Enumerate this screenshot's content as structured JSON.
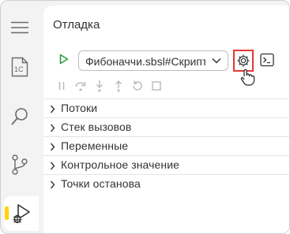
{
  "panel": {
    "title": "Отладка"
  },
  "activity_bar": {
    "items": [
      {
        "icon": "menu-icon"
      },
      {
        "icon": "1c-file-icon"
      },
      {
        "icon": "search-icon"
      },
      {
        "icon": "source-control-icon"
      },
      {
        "icon": "run-debug-icon",
        "active": true
      }
    ],
    "active_indicator_color": "#ffd400"
  },
  "toolbar": {
    "run_icon": "play-icon",
    "run_color": "#2e9e44",
    "configuration": "Фибоначчи.sbsl#Скрипт",
    "settings_icon": "gear-icon",
    "settings_highlight_color": "#e53935",
    "terminal_icon": "terminal-icon"
  },
  "debug_controls": [
    {
      "icon": "pause-icon"
    },
    {
      "icon": "step-over-icon"
    },
    {
      "icon": "step-into-icon"
    },
    {
      "icon": "step-out-icon"
    },
    {
      "icon": "restart-icon"
    },
    {
      "icon": "stop-icon"
    }
  ],
  "sections": [
    {
      "label": "Потоки"
    },
    {
      "label": "Стек вызовов"
    },
    {
      "label": "Переменные"
    },
    {
      "label": "Контрольное значение"
    },
    {
      "label": "Точки останова"
    }
  ]
}
